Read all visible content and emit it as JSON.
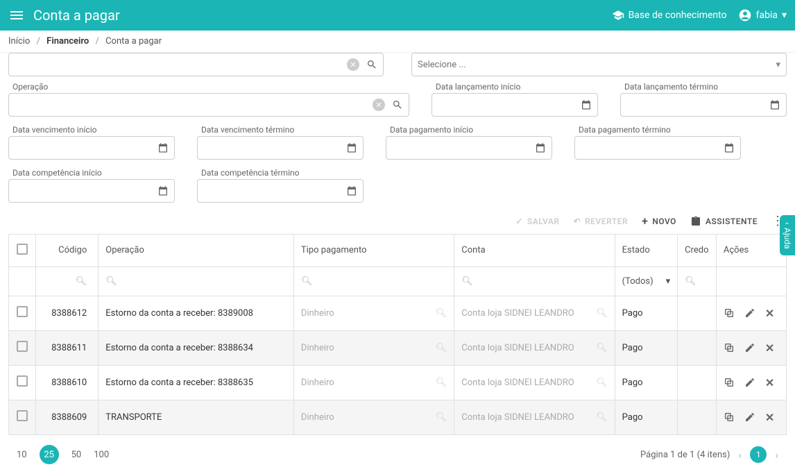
{
  "header": {
    "title": "Conta a pagar",
    "knowledge": "Base de conhecimento",
    "user": "fabia"
  },
  "breadcrumb": {
    "home": "Início",
    "finance": "Financeiro",
    "page": "Conta a pagar"
  },
  "filters": {
    "selecione_placeholder": "Selecione ...",
    "operacao": "Operação",
    "data_lanc_inicio": "Data lançamento início",
    "data_lanc_termino": "Data lançamento término",
    "data_venc_inicio": "Data vencimento início",
    "data_venc_termino": "Data vencimento término",
    "data_pag_inicio": "Data pagamento início",
    "data_pag_termino": "Data pagamento término",
    "data_comp_inicio": "Data competência início",
    "data_comp_termino": "Data competência término"
  },
  "toolbar": {
    "salvar": "SALVAR",
    "reverter": "REVERTER",
    "novo": "NOVO",
    "assistente": "ASSISTENTE"
  },
  "columns": {
    "codigo": "Código",
    "operacao": "Operação",
    "tipo": "Tipo pagamento",
    "conta": "Conta",
    "estado": "Estado",
    "credor": "Credo",
    "acoes": "Ações"
  },
  "estado_filter": "(Todos)",
  "rows": [
    {
      "codigo": "8388612",
      "operacao": "Estorno da conta a receber: 8389008",
      "tipo": "Dinheiro",
      "conta": "Conta loja SIDNEI LEANDRO",
      "estado": "Pago"
    },
    {
      "codigo": "8388611",
      "operacao": "Estorno da conta a receber: 8388634",
      "tipo": "Dinheiro",
      "conta": "Conta loja SIDNEI LEANDRO",
      "estado": "Pago"
    },
    {
      "codigo": "8388610",
      "operacao": "Estorno da conta a receber: 8388635",
      "tipo": "Dinheiro",
      "conta": "Conta loja SIDNEI LEANDRO",
      "estado": "Pago"
    },
    {
      "codigo": "8388609",
      "operacao": "TRANSPORTE",
      "tipo": "Dinheiro",
      "conta": "Conta loja SIDNEI LEANDRO",
      "estado": "Pago"
    }
  ],
  "pagination": {
    "sizes": [
      "10",
      "25",
      "50",
      "100"
    ],
    "active_size": "25",
    "info": "Página 1 de 1 (4 itens)",
    "page": "1"
  },
  "help": "Ajuda"
}
